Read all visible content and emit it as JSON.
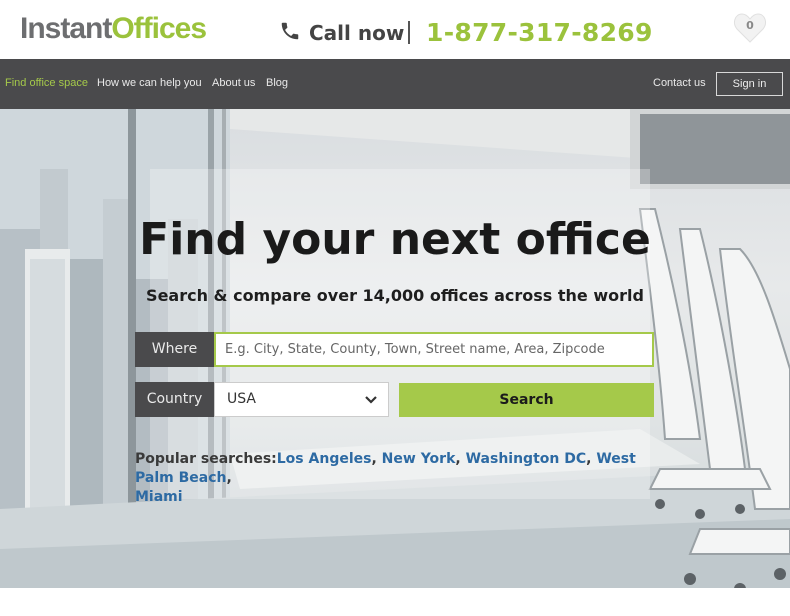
{
  "header": {
    "logo_part1": "Instant",
    "logo_part2": "Offices",
    "call_label": "Call now",
    "phone": "1-877-317-8269",
    "favorites_count": "0",
    "icons": [
      "phone-icon",
      "heart-icon"
    ]
  },
  "nav": {
    "items": [
      {
        "label": "Find office space",
        "active": true
      },
      {
        "label": "How we can help you",
        "active": false
      },
      {
        "label": "About us",
        "active": false
      },
      {
        "label": "Blog",
        "active": false
      }
    ],
    "contact": "Contact us",
    "signin": "Sign in"
  },
  "hero": {
    "title": "Find your next office",
    "subtitle": "Search & compare over 14,000 offices across the world"
  },
  "search": {
    "where_label": "Where",
    "where_placeholder": "E.g. City, State, County, Town, Street name, Area, Zipcode",
    "country_label": "Country",
    "country_value": "USA",
    "search_button": "Search"
  },
  "popular": {
    "label": "Popular searches:",
    "links": [
      "Los Angeles",
      "New York",
      "Washington DC",
      "West Palm Beach",
      "Miami"
    ]
  },
  "colors": {
    "brand_green": "#9bc23c",
    "nav_bg": "#4a4a4c",
    "link_blue": "#2d6aa3"
  }
}
